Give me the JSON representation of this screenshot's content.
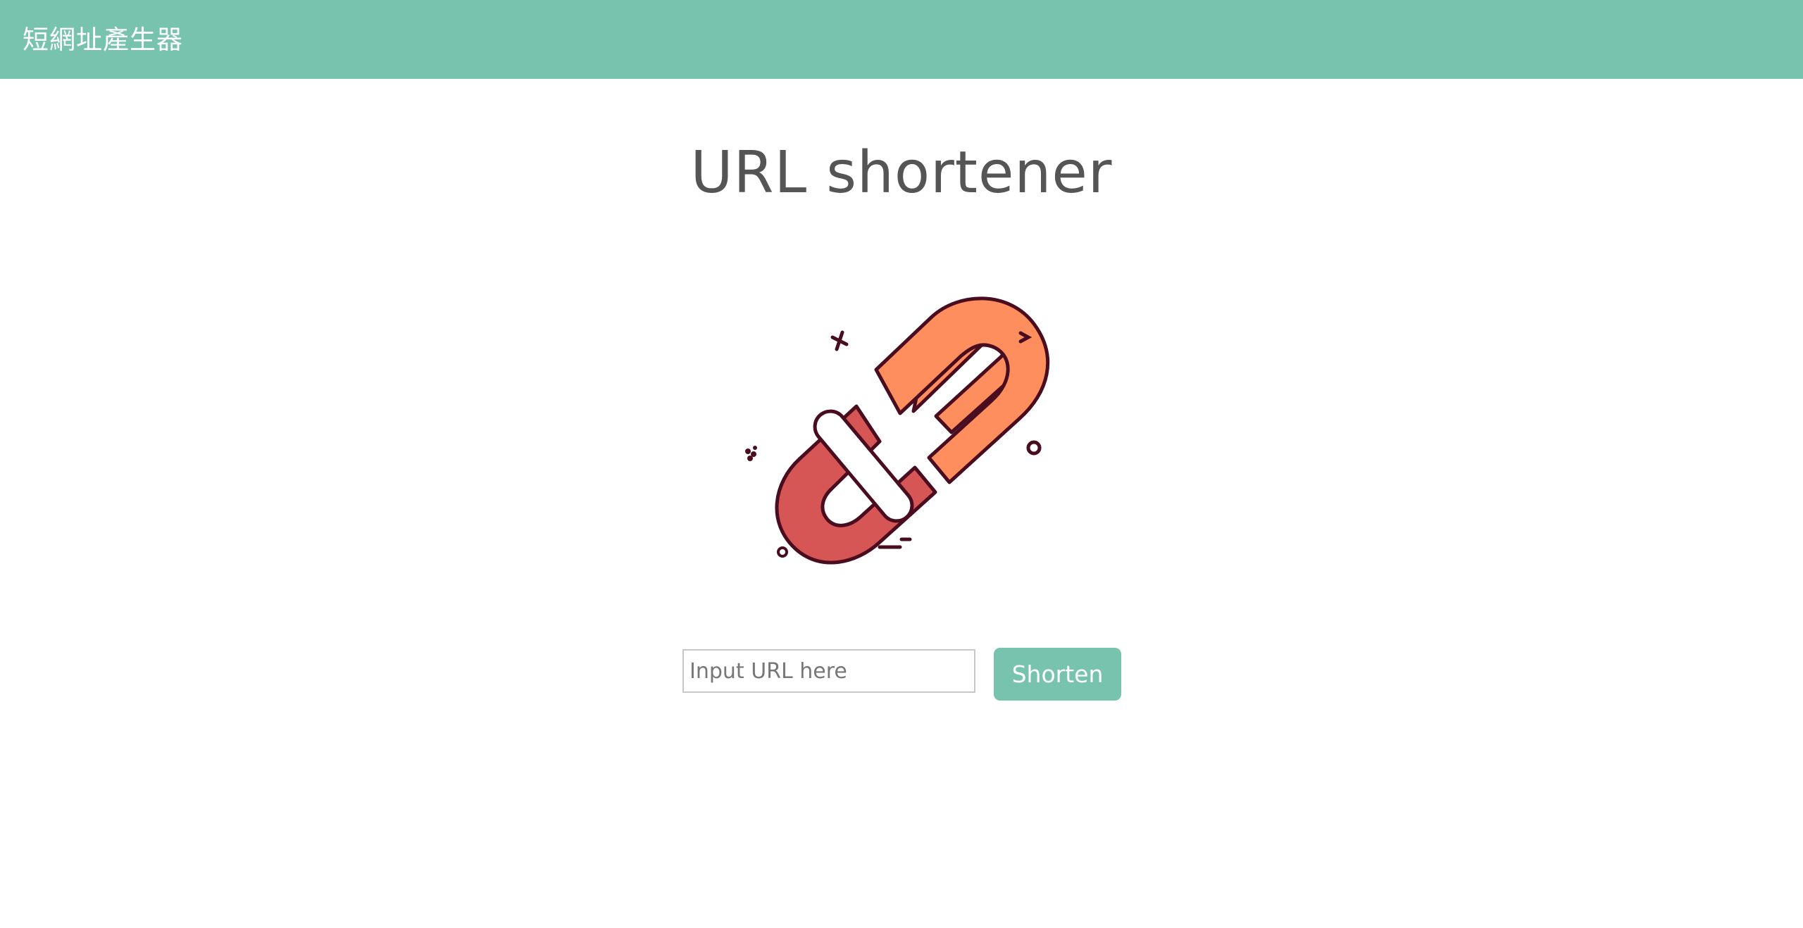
{
  "navbar": {
    "brand": "短網址產生器"
  },
  "main": {
    "title": "URL shortener",
    "illustration_icon": "broken-link-icon",
    "input": {
      "placeholder": "Input URL here",
      "value": ""
    },
    "button_label": "Shorten"
  },
  "colors": {
    "accent": "#78c3ad",
    "title_text": "#555555",
    "link_left": "#d65656",
    "link_right": "#ff8e5f",
    "outline": "#4a0d1f"
  }
}
